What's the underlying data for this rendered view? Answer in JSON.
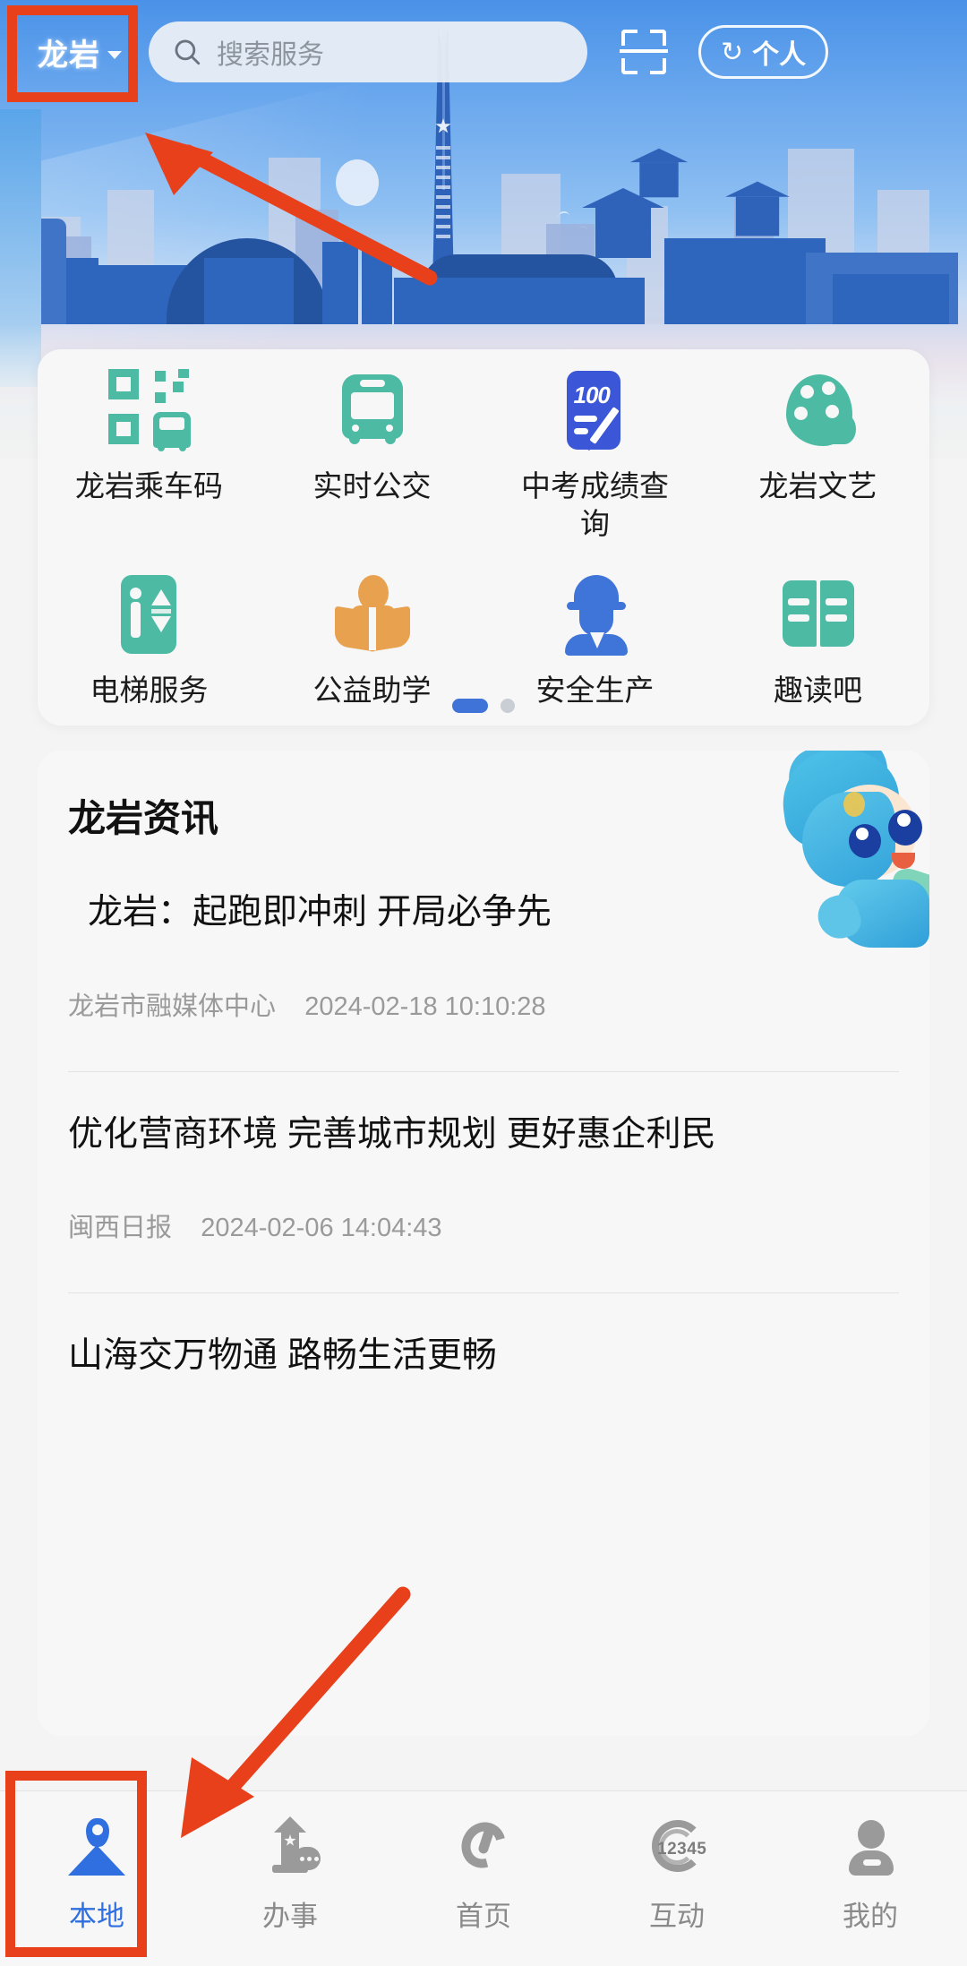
{
  "header": {
    "city": "龙岩",
    "city_caret_icon": "chevron-down-icon",
    "search_placeholder": "搜索服务",
    "search_icon": "search-icon",
    "scan_icon": "scan-qr-icon",
    "person_icon": "refresh-circle-icon",
    "person_label": "个人"
  },
  "services": {
    "rows": [
      [
        {
          "label": "龙岩乘车码",
          "icon": "qr-bus-code-icon",
          "color": "#4dbba4"
        },
        {
          "label": "实时公交",
          "icon": "bus-icon",
          "color": "#4dbba4"
        },
        {
          "label": "中考成绩查询",
          "icon": "exam-score-icon",
          "color": "#3b56d6"
        },
        {
          "label": "龙岩文艺",
          "icon": "palette-icon",
          "color": "#4dbba4"
        }
      ],
      [
        {
          "label": "电梯服务",
          "icon": "elevator-icon",
          "color": "#4dbba4"
        },
        {
          "label": "公益助学",
          "icon": "reading-person-icon",
          "color": "#e8a14e"
        },
        {
          "label": "安全生产",
          "icon": "safety-worker-icon",
          "color": "#3f74d8"
        },
        {
          "label": "趣读吧",
          "icon": "open-book-icon",
          "color": "#4dbba4"
        }
      ]
    ],
    "pagination": {
      "total": 2,
      "active": 1
    }
  },
  "news": {
    "section_title": "龙岩资讯",
    "mascot_icon": "blue-mascot-character",
    "items": [
      {
        "headline": "龙岩：起跑即冲刺 开局必争先",
        "source": "龙岩市融媒体中心",
        "timestamp": "2024-02-18 10:10:28"
      },
      {
        "headline": "优化营商环境 完善城市规划 更好惠企利民",
        "source": "闽西日报",
        "timestamp": "2024-02-06 14:04:43"
      },
      {
        "headline": "山海交万物通 路畅生活更畅",
        "source": "",
        "timestamp": ""
      }
    ]
  },
  "tabbar": {
    "items": [
      {
        "label": "本地",
        "icon": "location-person-icon",
        "active": true
      },
      {
        "label": "办事",
        "icon": "service-pillar-icon",
        "active": false
      },
      {
        "label": "首页",
        "icon": "home-swirl-icon",
        "active": false
      },
      {
        "label": "互动",
        "icon": "hotline-12345-icon",
        "active": false
      },
      {
        "label": "我的",
        "icon": "user-profile-icon",
        "active": false
      }
    ],
    "hotline_number": "12345"
  },
  "annotations": {
    "accent_color": "#e8401a",
    "boxes": [
      "city-selector-highlight",
      "local-tab-highlight"
    ],
    "arrows": [
      "arrow-to-city-selector",
      "arrow-to-local-tab"
    ]
  },
  "colors": {
    "primary_blue": "#2f6fe0",
    "teal": "#4dbba4",
    "orange": "#e8a14e",
    "annotation_red": "#e8401a",
    "banner_blue": "#4a92e8"
  }
}
